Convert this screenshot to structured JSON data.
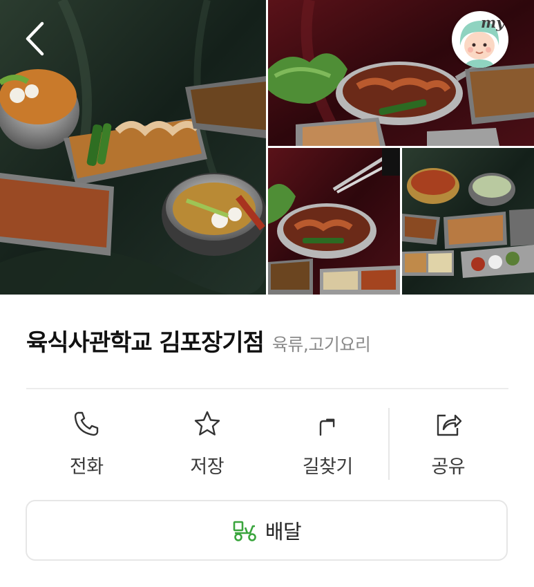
{
  "header": {
    "back_icon": "chevron-left-icon",
    "profile_badge": "my"
  },
  "gallery": {
    "photos": [
      "main-dish-spread",
      "stirfry-pan-spread",
      "tongs-serving-pan",
      "side-dishes-spread"
    ]
  },
  "store": {
    "name": "육식사관학교 김포장기점",
    "category": "육류,고기요리"
  },
  "actions": [
    {
      "label": "전화",
      "icon": "phone-icon"
    },
    {
      "label": "저장",
      "icon": "star-icon"
    },
    {
      "label": "길찾기",
      "icon": "directions-icon"
    },
    {
      "label": "공유",
      "icon": "share-icon"
    }
  ],
  "delivery": {
    "label": "배달",
    "icon": "delivery-scooter-icon",
    "icon_color": "#3aa53d"
  },
  "colors": {
    "velvet_dark": "#1c2a20",
    "velvet_red": "#4a0f16",
    "divider": "#ececec"
  }
}
